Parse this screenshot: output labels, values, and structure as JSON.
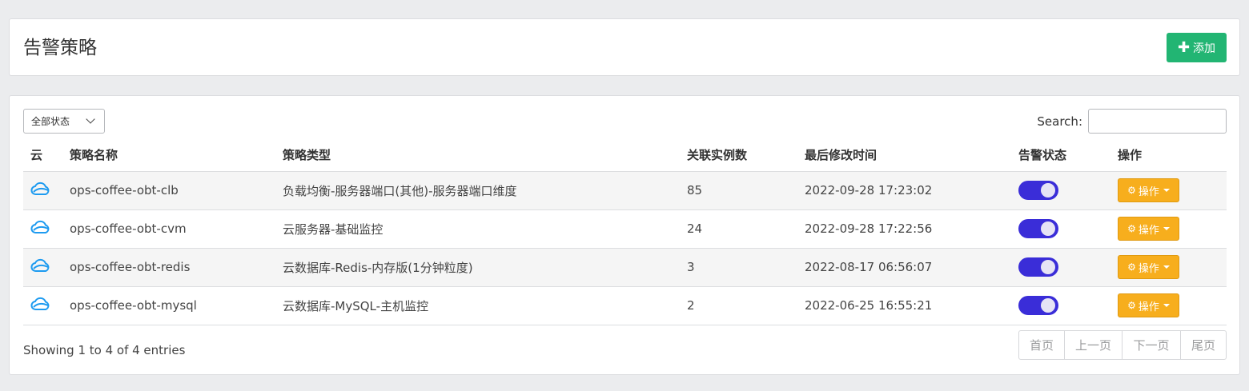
{
  "header": {
    "title": "告警策略",
    "add_label": "添加"
  },
  "filter": {
    "status_select": "全部状态",
    "search_label": "Search:",
    "search_value": ""
  },
  "table": {
    "columns": [
      "云",
      "策略名称",
      "策略类型",
      "关联实例数",
      "最后修改时间",
      "告警状态",
      "操作"
    ],
    "rows": [
      {
        "name": "ops-coffee-obt-clb",
        "type": "负载均衡-服务器端口(其他)-服务器端口维度",
        "count": "85",
        "time": "2022-09-28 17:23:02",
        "enabled": true,
        "action": "操作"
      },
      {
        "name": "ops-coffee-obt-cvm",
        "type": "云服务器-基础监控",
        "count": "24",
        "time": "2022-09-28 17:22:56",
        "enabled": true,
        "action": "操作"
      },
      {
        "name": "ops-coffee-obt-redis",
        "type": "云数据库-Redis-内存版(1分钟粒度)",
        "count": "3",
        "time": "2022-08-17 06:56:07",
        "enabled": true,
        "action": "操作"
      },
      {
        "name": "ops-coffee-obt-mysql",
        "type": "云数据库-MySQL-主机监控",
        "count": "2",
        "time": "2022-06-25 16:55:21",
        "enabled": true,
        "action": "操作"
      }
    ]
  },
  "footer": {
    "info": "Showing 1 to 4 of 4 entries"
  },
  "pager": {
    "first": "首页",
    "prev": "上一页",
    "next": "下一页",
    "last": "尾页"
  },
  "colors": {
    "accent_green": "#22b573",
    "toggle_on": "#3a2dd8",
    "action_orange": "#f7ae1d",
    "cloud_blue": "#1e9bf0"
  }
}
